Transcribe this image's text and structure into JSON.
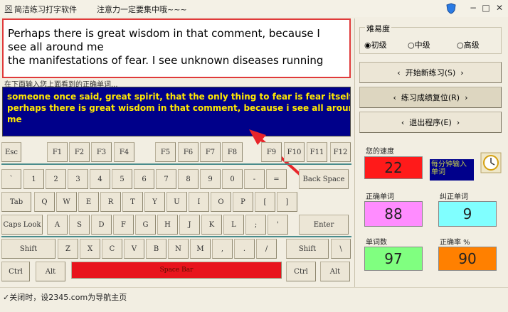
{
  "window": {
    "title": "简洁练习打字软件",
    "subtitle": "注意力一定要集中哦~~~",
    "icon": "app-icon",
    "buttons": {
      "minimize": "−",
      "restore": "□",
      "close": "✕"
    }
  },
  "reading": {
    "text": "Perhaps there is great wisdom in that comment, because I\nsee all around me\nthe manifestations of fear. I see unknown diseases running"
  },
  "input": {
    "label": "在下面输入您上面看到的正确单词...",
    "text": "someone once said, great spirit, that the only thing to fear is fear itself.\nperhaps there is great wisdom in that comment, because i see all aroun\nme"
  },
  "keyboard": {
    "row0": [
      "Esc",
      "F1",
      "F2",
      "F3",
      "F4",
      "F5",
      "F6",
      "F7",
      "F8",
      "F9",
      "F10",
      "F11",
      "F12"
    ],
    "row1": [
      "`",
      "1",
      "2",
      "3",
      "4",
      "5",
      "6",
      "7",
      "8",
      "9",
      "0",
      "-",
      "=",
      "Back Space"
    ],
    "row2": [
      "Tab",
      "Q",
      "W",
      "E",
      "R",
      "T",
      "Y",
      "U",
      "I",
      "O",
      "P",
      "[",
      "]"
    ],
    "row3": [
      "Caps Look",
      "A",
      "S",
      "D",
      "F",
      "G",
      "H",
      "J",
      "K",
      "L",
      ";",
      "'",
      "Enter"
    ],
    "row4": [
      "Shift",
      "Z",
      "X",
      "C",
      "V",
      "B",
      "N",
      "M",
      ",",
      ".",
      "/",
      "Shift",
      "\\"
    ],
    "row5": [
      "Ctrl",
      "Alt",
      "Space Bar",
      "Ctrl",
      "Alt"
    ]
  },
  "difficulty": {
    "legend": "难易度",
    "options": [
      "初级",
      "中级",
      "高级"
    ],
    "selected": "初级"
  },
  "actions": {
    "start": "开始新练习(S)",
    "reset": "练习成绩复位(R)",
    "exit": "退出程序(E)"
  },
  "stats": {
    "speed_label": "您的速度",
    "speed_value": "22",
    "speed_unit": "每分钟输入单词",
    "correct_label": "正确单词",
    "correct_value": "88",
    "fixed_label": "纠正单词",
    "fixed_value": "9",
    "total_label": "单词数",
    "total_value": "97",
    "rate_label": "正确率 %",
    "rate_value": "90"
  },
  "colors": {
    "speed_bg": "#ff1a1a",
    "unit_bg": "#00008b",
    "correct_bg": "#ff8cff",
    "fixed_bg": "#80ffff",
    "total_bg": "#80ff80",
    "rate_bg": "#ff8000"
  },
  "status": {
    "text": "关闭时，设2345.com为导航主页"
  }
}
